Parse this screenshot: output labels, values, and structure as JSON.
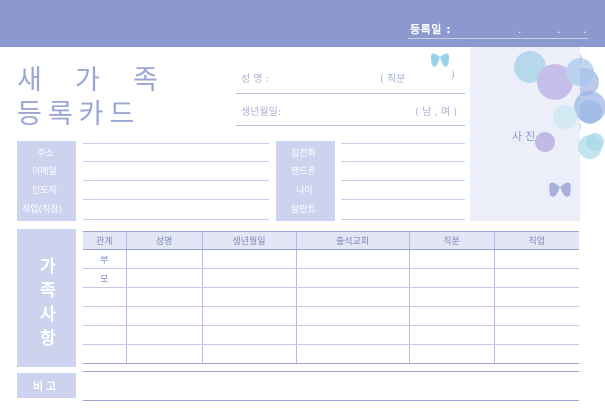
{
  "header": {
    "reg_date_label": "등록일 :",
    "reg_date_dots": [
      ".",
      ".",
      "."
    ]
  },
  "title": {
    "line1": [
      "새",
      "가",
      "족"
    ],
    "line2": "등록카드"
  },
  "fields": {
    "name_label": "성     명 :",
    "position_label": "( 직분",
    "position_close": ")",
    "birth_label": "생년월일:",
    "gender_label": "( 남 , 여 )"
  },
  "photo_label": "사진",
  "info_left": [
    "주소",
    "이메일",
    "인도자",
    "직업(직장)"
  ],
  "info_right": [
    "집전화",
    "핸드폰",
    "나이",
    "달란트"
  ],
  "family": {
    "side_label": [
      "가",
      "족",
      "사",
      "항"
    ],
    "headers": [
      "관계",
      "성명",
      "생년월일",
      "출석교회",
      "직분",
      "직업"
    ],
    "rows": [
      [
        "부",
        "",
        "",
        "",
        "",
        ""
      ],
      [
        "모",
        "",
        "",
        "",
        "",
        ""
      ],
      [
        "",
        "",
        "",
        "",
        "",
        ""
      ],
      [
        "",
        "",
        "",
        "",
        "",
        ""
      ],
      [
        "",
        "",
        "",
        "",
        "",
        ""
      ],
      [
        "",
        "",
        "",
        "",
        "",
        ""
      ]
    ]
  },
  "remarks_label": "비고",
  "colors": {
    "header_band": "#8c99ce",
    "label_bar": "#cdd3ef",
    "accent_text": "#9aa5d6"
  }
}
